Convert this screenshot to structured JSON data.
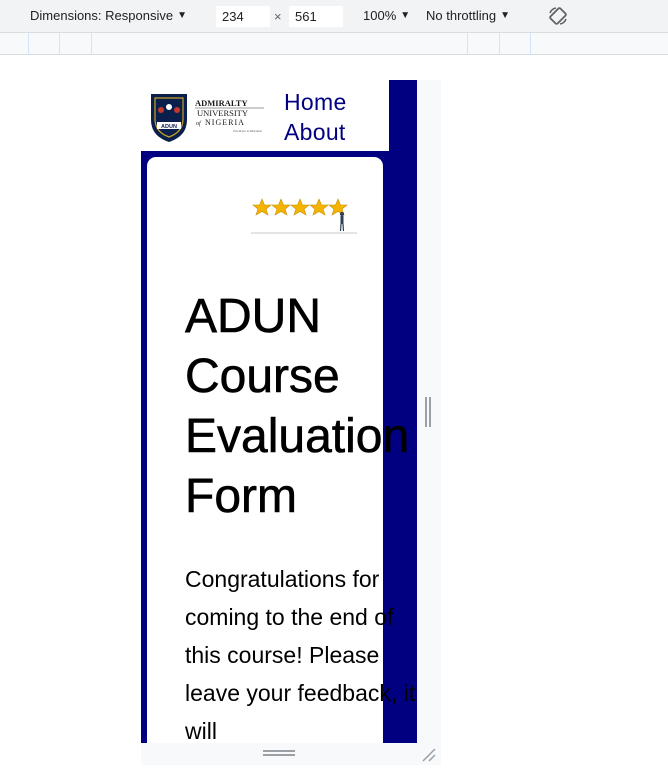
{
  "devtools": {
    "dimensions_label": "Dimensions: Responsive",
    "width_value": "234",
    "times": "×",
    "height_value": "561",
    "zoom": "100%",
    "throttling": "No throttling",
    "icons": [
      "chevron-down-icon",
      "rotate-icon"
    ]
  },
  "nav": {
    "logo_alt": "Admiralty University of Nigeria",
    "links": [
      "Home",
      "About"
    ],
    "color": "#000080"
  },
  "main": {
    "title": "ADUN Course Evaluation Form",
    "intro": "Congratulations for coming to the end of this course! Please leave your feedback, it will",
    "accent": "#000080"
  }
}
